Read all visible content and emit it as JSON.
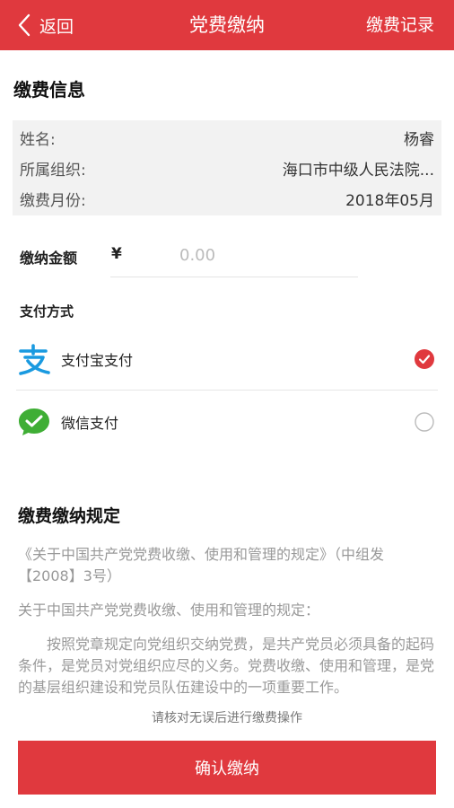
{
  "nav": {
    "back_label": "返回",
    "title": "党费缴纳",
    "right_label": "缴费记录"
  },
  "info": {
    "section_title": "缴费信息",
    "rows": [
      {
        "label": "姓名:",
        "value": "杨睿"
      },
      {
        "label": "所属组织:",
        "value": "海口市中级人民法院..."
      },
      {
        "label": "缴费月份:",
        "value": "2018年05月"
      }
    ]
  },
  "amount": {
    "label": "缴纳金额",
    "currency": "¥",
    "placeholder": "0.00",
    "value": ""
  },
  "payment": {
    "title": "支付方式",
    "methods": [
      {
        "label": "支付宝支付",
        "icon": "alipay-icon",
        "selected": true
      },
      {
        "label": "微信支付",
        "icon": "wechat-pay-icon",
        "selected": false
      }
    ]
  },
  "rules": {
    "title": "缴费缴纳规定",
    "paragraphs": [
      "《关于中国共产党党费收缴、使用和管理的规定》（中组发【2008】3号）",
      "关于中国共产党党费收缴、使用和管理的规定：",
      "按照党章规定向党组织交纳党费，是共产党员必须具备的起码条件，是党员对党组织应尽的义务。党费收缴、使用和管理，是党的基层组织建设和党员队伍建设中的一项重要工作。"
    ]
  },
  "footer": {
    "hint": "请核对无误后进行缴费操作",
    "confirm_label": "确认缴纳"
  },
  "colors": {
    "brand_red": "#e0393e",
    "alipay_blue": "#1a9ae0",
    "wechat_green": "#3fae35"
  }
}
